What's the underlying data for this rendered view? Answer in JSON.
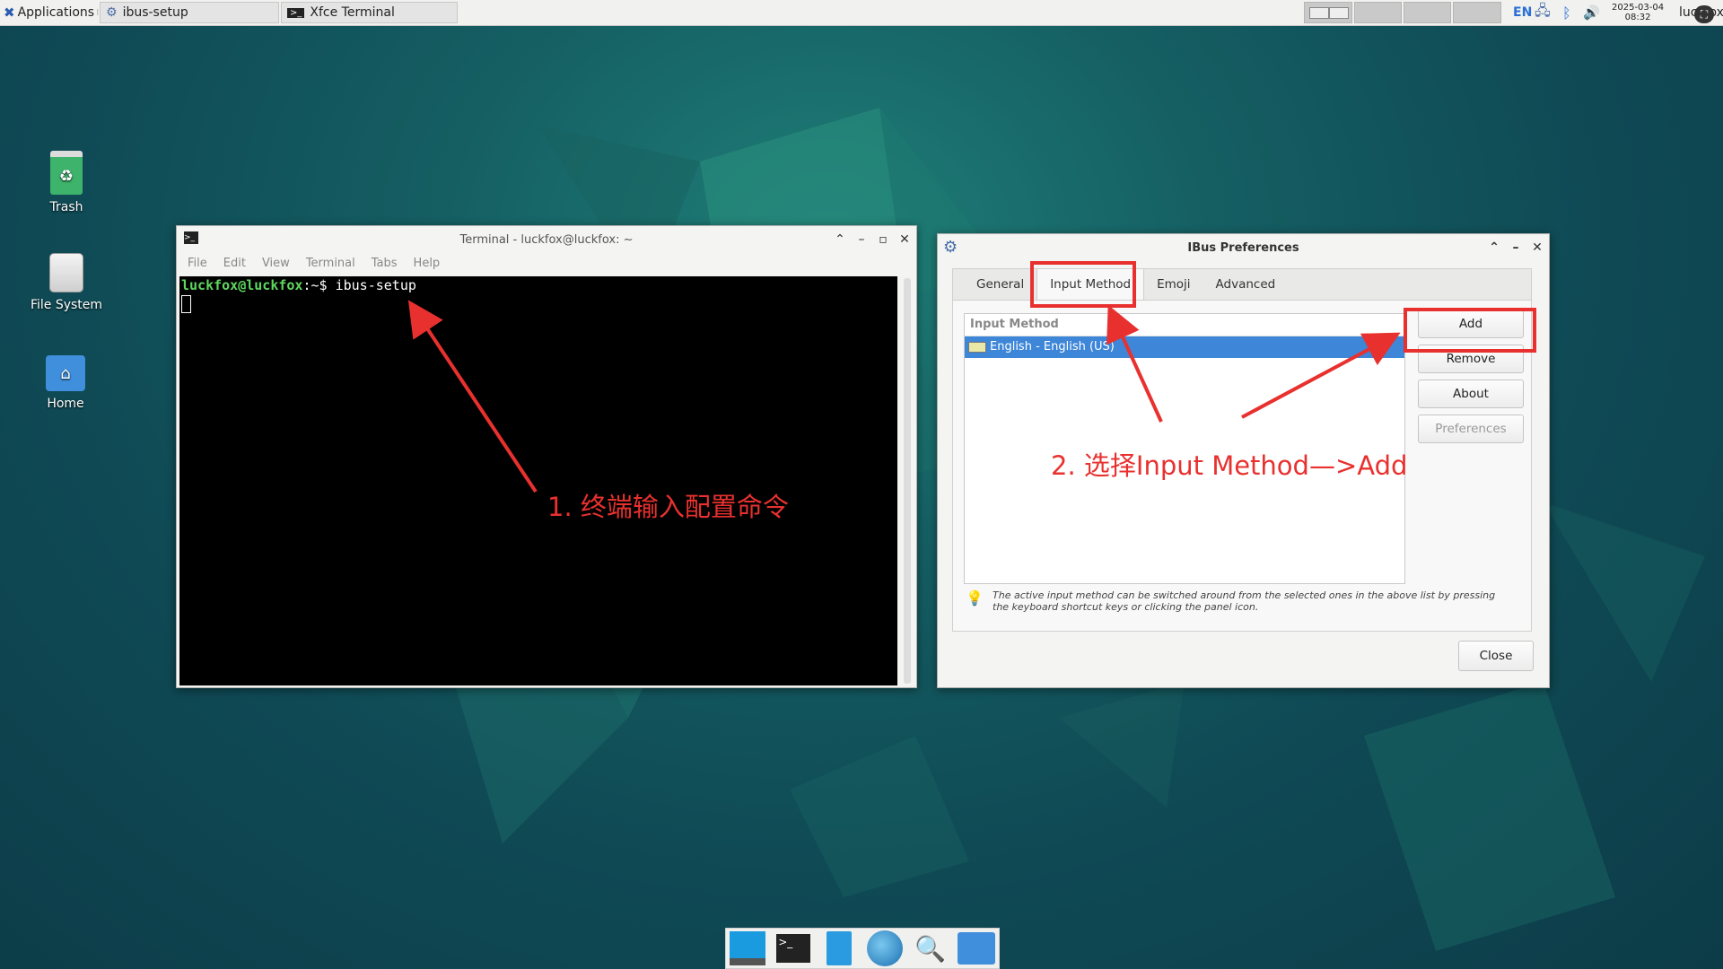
{
  "top_panel": {
    "applications_label": "Applications",
    "tasks": [
      {
        "label": "ibus-setup"
      },
      {
        "label": "Xfce Terminal"
      }
    ],
    "lang_indicator": "EN",
    "date": "2025-03-04",
    "time": "08:32",
    "user": "luckfox"
  },
  "desktop": {
    "icons": [
      {
        "label": "Trash"
      },
      {
        "label": "File System"
      },
      {
        "label": "Home"
      }
    ]
  },
  "terminal": {
    "title": "Terminal - luckfox@luckfox: ~",
    "menu": [
      "File",
      "Edit",
      "View",
      "Terminal",
      "Tabs",
      "Help"
    ],
    "prompt_user": "luckfox@luckfox",
    "prompt_path": ":~$",
    "command": " ibus-setup"
  },
  "ibus": {
    "title": "IBus Preferences",
    "tabs": [
      "General",
      "Input Method",
      "Emoji",
      "Advanced"
    ],
    "list_header": "Input Method",
    "list_items": [
      "English - English (US)"
    ],
    "buttons": {
      "add": "Add",
      "remove": "Remove",
      "about": "About",
      "preferences": "Preferences",
      "close": "Close"
    },
    "hint": "The active input method can be switched around from the selected ones in the above list by pressing the keyboard shortcut keys or clicking the panel icon."
  },
  "annotations": {
    "step1": "1. 终端输入配置命令",
    "step2": "2. 选择Input Method—>Add"
  },
  "colors": {
    "annotation_red": "#e8312f",
    "selection_blue": "#3d86d8",
    "prompt_green": "#5fd75f"
  }
}
